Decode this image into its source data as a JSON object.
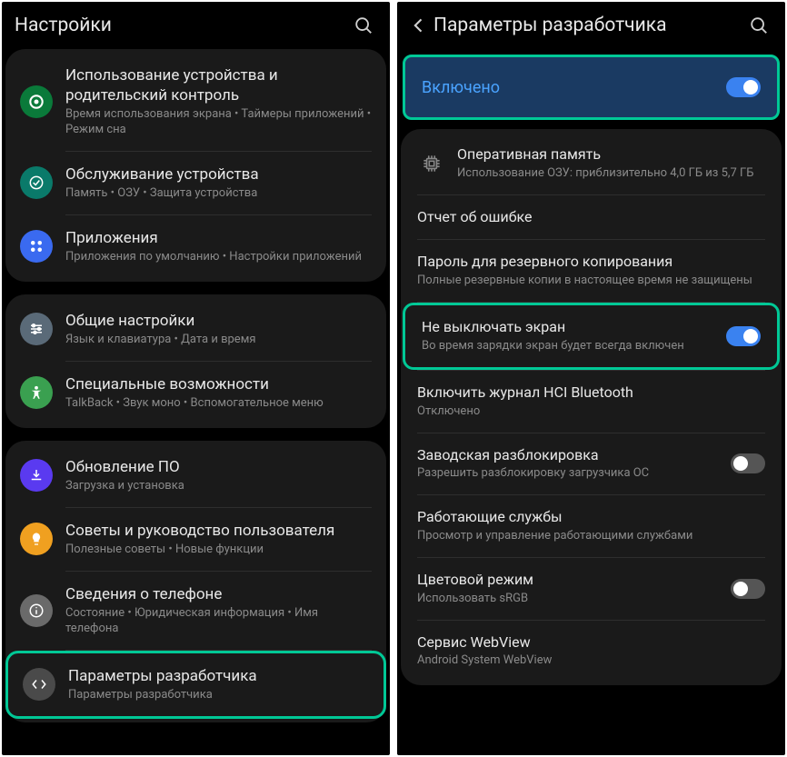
{
  "left": {
    "header": {
      "title": "Настройки"
    },
    "groups": [
      [
        {
          "id": "device-usage",
          "label": "Использование устройства и родительский контроль",
          "sub": "Время использования экрана  •  Таймеры приложений  •  Режим сна",
          "iconBg": "#0a7a3a"
        },
        {
          "id": "device-care",
          "label": "Обслуживание устройства",
          "sub": "Память  •  ОЗУ  •  Защита устройства",
          "iconBg": "#0a7a6a"
        },
        {
          "id": "apps",
          "label": "Приложения",
          "sub": "Приложения по умолчанию  •  Настройки приложений",
          "iconBg": "#3a6af0"
        }
      ],
      [
        {
          "id": "general",
          "label": "Общие настройки",
          "sub": "Язык и клавиатура  •  Дата и время",
          "iconBg": "#5a6a78"
        },
        {
          "id": "accessibility",
          "label": "Специальные возможности",
          "sub": "TalkBack  •  Звук моно  •  Вспомогательное меню",
          "iconBg": "#3aa050"
        }
      ],
      [
        {
          "id": "software-update",
          "label": "Обновление ПО",
          "sub": "Загрузка и установка",
          "iconBg": "#5a3af0"
        },
        {
          "id": "tips",
          "label": "Советы и руководство пользователя",
          "sub": "Полезные советы  •  Новые функции",
          "iconBg": "#f0a020"
        },
        {
          "id": "about-phone",
          "label": "Сведения о телефоне",
          "sub": "Состояние  •  Юридическая информация  •  Имя телефона",
          "iconBg": "#6a6a6a"
        },
        {
          "id": "developer-options",
          "label": "Параметры разработчика",
          "sub": "Параметры разработчика",
          "iconBg": "#4a4a4a",
          "highlight": true
        }
      ]
    ]
  },
  "right": {
    "header": {
      "title": "Параметры разработчика"
    },
    "enabled": {
      "label": "Включено",
      "on": true
    },
    "items": [
      {
        "id": "memory",
        "label": "Оперативная память",
        "sub": "Использование ОЗУ: приблизительно 4,0 ГБ из 5,7 ГБ",
        "icon": true
      },
      {
        "id": "bug-report",
        "label": "Отчет об ошибке"
      },
      {
        "id": "backup-password",
        "label": "Пароль для резервного копирования",
        "sub": "Полные резервные копии в настоящее время не защищены"
      },
      {
        "id": "stay-awake",
        "label": "Не выключать экран",
        "sub": "Во время зарядки экран будет всегда включен",
        "toggle": true,
        "on": true,
        "highlight": true
      },
      {
        "id": "bt-hci",
        "label": "Включить журнал HCI Bluetooth",
        "sub": "Отключено"
      },
      {
        "id": "oem-unlock",
        "label": "Заводская разблокировка",
        "sub": "Разрешить разблокировку загрузчика ОС",
        "toggle": true,
        "on": false
      },
      {
        "id": "running-services",
        "label": "Работающие службы",
        "sub": "Просмотр и управление работающими службами"
      },
      {
        "id": "color-mode",
        "label": "Цветовой режим",
        "sub": "Использовать sRGB",
        "toggle": true,
        "on": false
      },
      {
        "id": "webview",
        "label": "Сервис WebView",
        "sub": "Android System WebView"
      }
    ]
  }
}
